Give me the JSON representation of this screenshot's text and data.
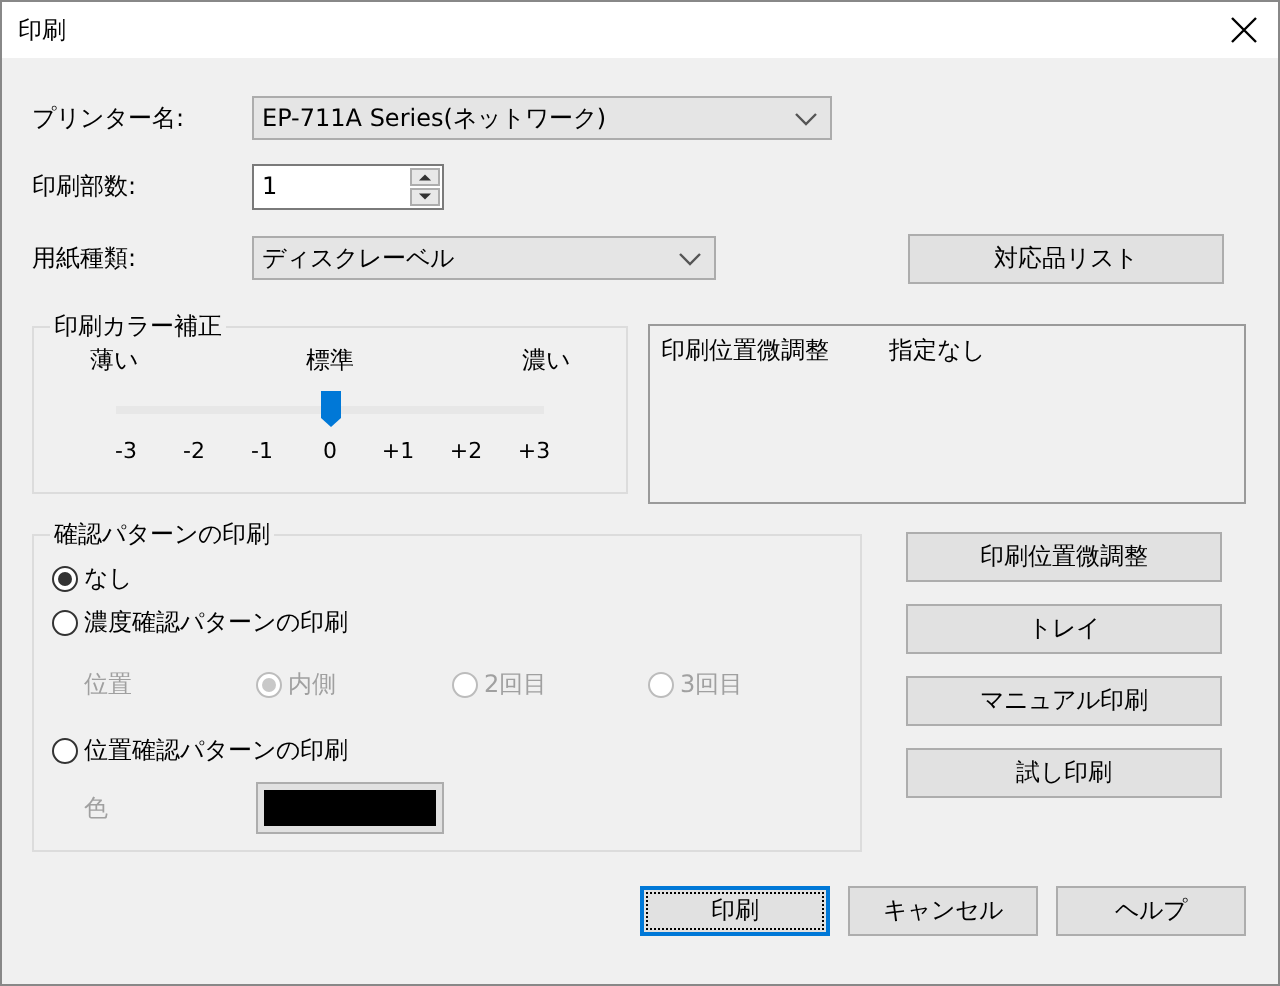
{
  "window": {
    "title": "印刷"
  },
  "printer": {
    "label": "プリンター名:",
    "value": "EP-711A Series(ネットワーク)"
  },
  "copies": {
    "label": "印刷部数:",
    "value": "1"
  },
  "paper": {
    "label": "用紙種類:",
    "value": "ディスクレーベル"
  },
  "compat_button": "対応品リスト",
  "color_correction": {
    "title": "印刷カラー補正",
    "labels": [
      "薄い",
      "標準",
      "濃い"
    ],
    "level": 0.5,
    "ticks": [
      "-3",
      "-2",
      "-1",
      "0",
      "+1",
      "+2",
      "+3"
    ]
  },
  "position_info": {
    "label": "印刷位置微調整",
    "value": "指定なし"
  },
  "pattern": {
    "title": "確認パターンの印刷",
    "options": [
      {
        "label": "なし",
        "selected": true
      },
      {
        "label": "濃度確認パターンの印刷",
        "selected": false
      },
      {
        "label": "位置確認パターンの印刷",
        "selected": false
      }
    ],
    "position": {
      "label": "位置",
      "disabled": true,
      "options": [
        {
          "label": "内側",
          "selected": true
        },
        {
          "label": "2回目",
          "selected": false
        },
        {
          "label": "3回目",
          "selected": false
        }
      ]
    },
    "color": {
      "label": "色",
      "color": "#000000"
    }
  },
  "side_buttons": [
    "印刷位置微調整",
    "トレイ",
    "マニュアル印刷",
    "試し印刷"
  ],
  "buttons": [
    {
      "label": "印刷",
      "focused": true
    },
    {
      "label": "キャンセル",
      "focused": false
    },
    {
      "label": "ヘルプ",
      "focused": false
    }
  ]
}
